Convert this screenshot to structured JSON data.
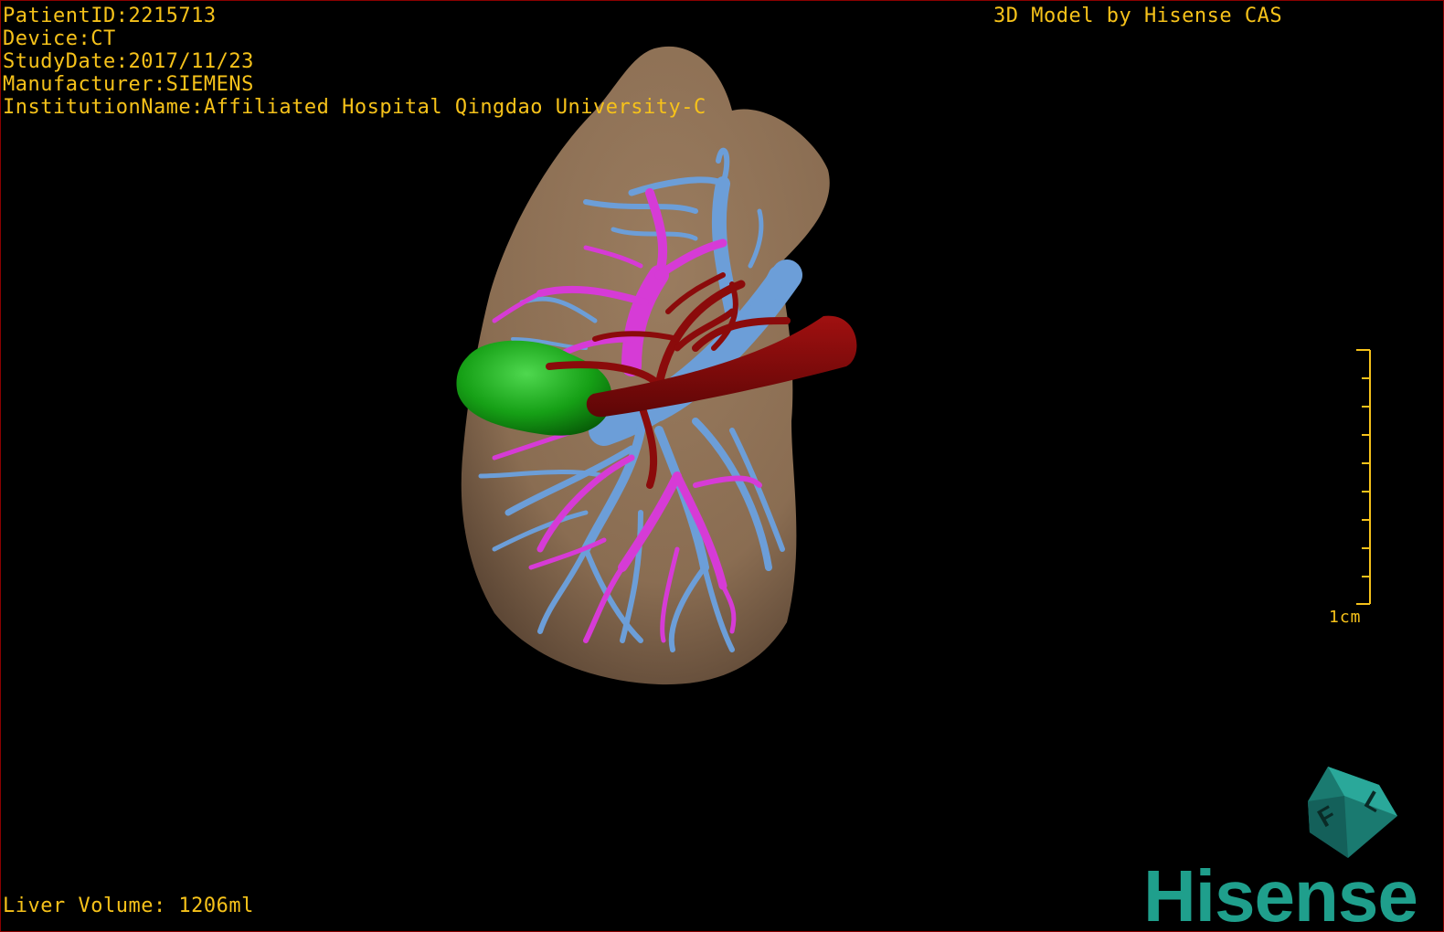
{
  "overlay": {
    "patient_id": "PatientID:2215713",
    "device": "Device:CT",
    "study_date": "StudyDate:2017/11/23",
    "manufacturer": "Manufacturer:SIEMENS",
    "institution": "InstitutionName:Affiliated Hospital Qingdao University-C",
    "brand_title": "3D Model by Hisense CAS",
    "liver_volume": "Liver Volume: 1206ml"
  },
  "scale_bar": {
    "label": "1cm"
  },
  "orientation_cube": {
    "letters": [
      "F",
      "L"
    ]
  },
  "logo": {
    "text": "Hisense"
  },
  "colors": {
    "liver": "#8c7055",
    "portal_vein": "#6c9ed8",
    "hepatic_vein": "#d63bd6",
    "artery": "#8b0b0b",
    "gallbladder": "#1aa51a",
    "overlay_text": "#f6c21a",
    "brand": "#1f9f8c"
  }
}
